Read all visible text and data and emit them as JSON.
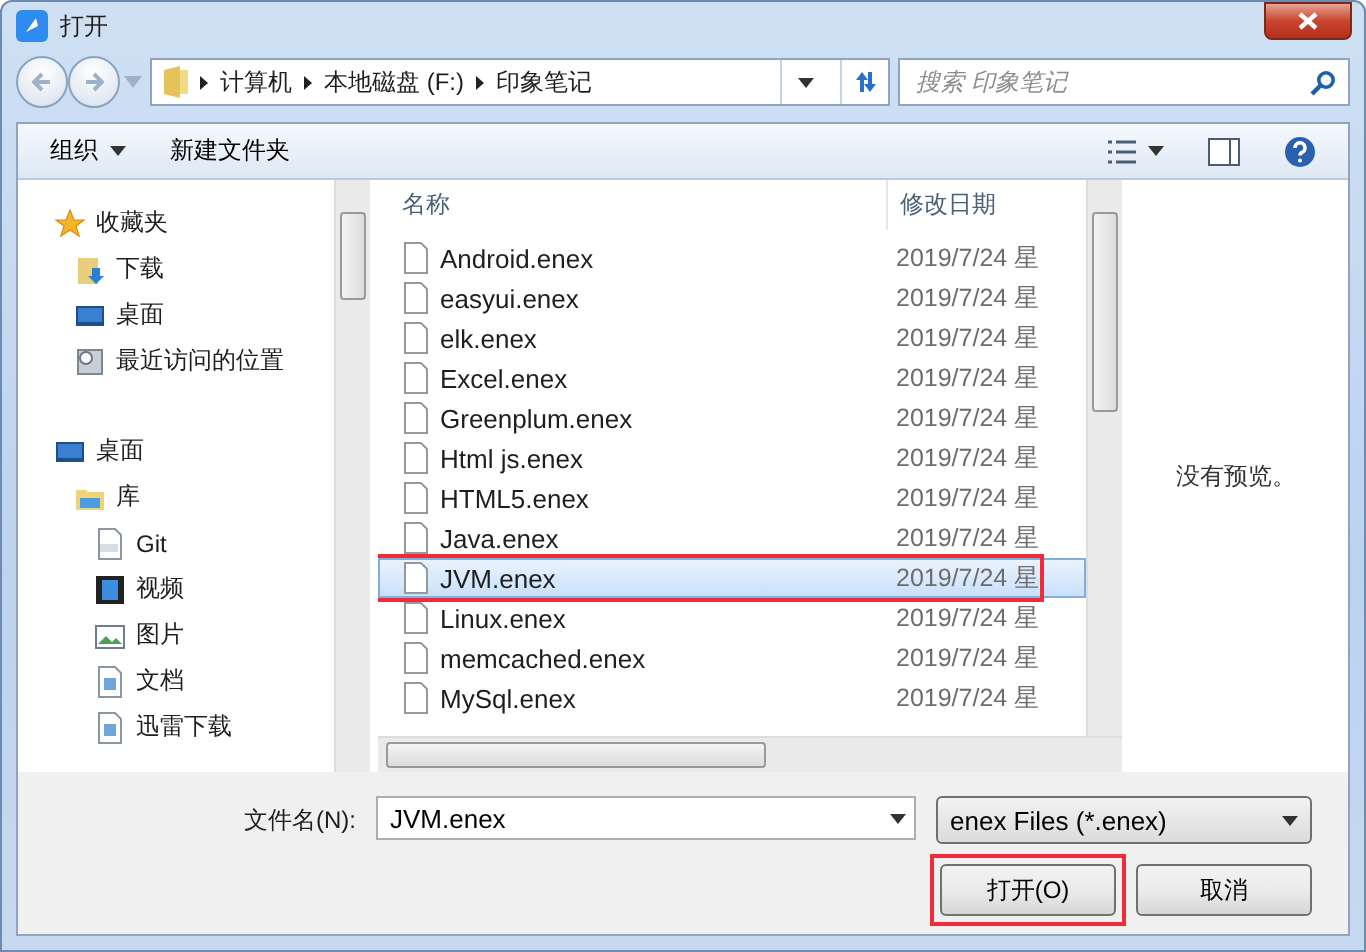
{
  "window": {
    "title": "打开"
  },
  "address": {
    "crumbs": [
      "计算机",
      "本地磁盘 (F:)",
      "印象笔记"
    ]
  },
  "search": {
    "placeholder": "搜索 印象笔记"
  },
  "toolbar": [
    {
      "label": "组织",
      "kind": "menu"
    },
    {
      "label": "新建文件夹",
      "kind": "plain"
    }
  ],
  "nav": [
    {
      "label": "收藏夹",
      "kind": "star",
      "children": [
        {
          "label": "下载",
          "kind": "download"
        },
        {
          "label": "桌面",
          "kind": "desktop"
        },
        {
          "label": "最近访问的位置",
          "kind": "recent"
        }
      ]
    },
    {
      "label": "桌面",
      "kind": "desktop",
      "children": [
        {
          "label": "库",
          "kind": "library",
          "children": [
            {
              "label": "Git",
              "kind": "git"
            },
            {
              "label": "视频",
              "kind": "video"
            },
            {
              "label": "图片",
              "kind": "picture"
            },
            {
              "label": "文档",
              "kind": "document"
            },
            {
              "label": "迅雷下载",
              "kind": "document"
            }
          ]
        }
      ]
    }
  ],
  "columns": [
    "名称",
    "修改日期"
  ],
  "files": [
    {
      "name": "Android.enex",
      "date": "2019/7/24 星",
      "selected": false,
      "annotated": false
    },
    {
      "name": "easyui.enex",
      "date": "2019/7/24 星",
      "selected": false,
      "annotated": false
    },
    {
      "name": "elk.enex",
      "date": "2019/7/24 星",
      "selected": false,
      "annotated": false
    },
    {
      "name": "Excel.enex",
      "date": "2019/7/24 星",
      "selected": false,
      "annotated": false
    },
    {
      "name": "Greenplum.enex",
      "date": "2019/7/24 星",
      "selected": false,
      "annotated": false
    },
    {
      "name": "Html js.enex",
      "date": "2019/7/24 星",
      "selected": false,
      "annotated": false
    },
    {
      "name": "HTML5.enex",
      "date": "2019/7/24 星",
      "selected": false,
      "annotated": false
    },
    {
      "name": "Java.enex",
      "date": "2019/7/24 星",
      "selected": false,
      "annotated": false
    },
    {
      "name": "JVM.enex",
      "date": "2019/7/24 星",
      "selected": true,
      "annotated": true
    },
    {
      "name": "Linux.enex",
      "date": "2019/7/24 星",
      "selected": false,
      "annotated": false
    },
    {
      "name": "memcached.enex",
      "date": "2019/7/24 星",
      "selected": false,
      "annotated": false
    },
    {
      "name": "MySql.enex",
      "date": "2019/7/24 星",
      "selected": false,
      "annotated": false
    }
  ],
  "preview": "没有预览。",
  "filename": {
    "label": "文件名(N):",
    "value": "JVM.enex"
  },
  "filetype": {
    "value": "enex Files (*.enex)"
  },
  "buttons": [
    {
      "label": "打开(O)",
      "annotated": true
    },
    {
      "label": "取消",
      "annotated": false
    }
  ]
}
